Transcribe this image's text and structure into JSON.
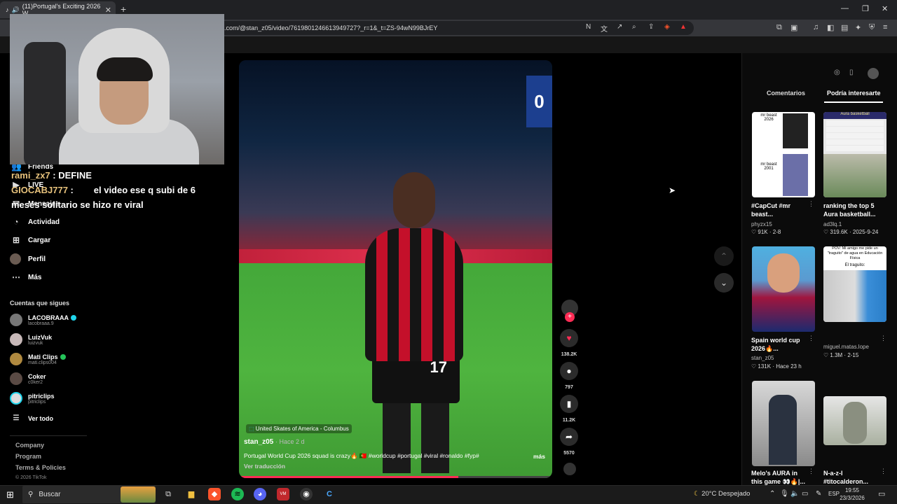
{
  "browser": {
    "tab_title": "(11)Portugal's Exciting 2026 W",
    "new_tab": "+",
    "url": ".com/@stan_z05/video/7619801246613949727?_r=1&_t=ZS-94wN99BJrEY"
  },
  "overlay_chat": {
    "line1_user": "rami_zx7",
    "line1_text": ": DEFINE",
    "line2_user": "GIOCABJ777",
    "line2_text": "el video ese q subi de 6",
    "line3_text": "meses solitario se hizo re viral"
  },
  "sidebar": {
    "partial_items": [
      "Friends",
      "LIVE",
      "Mensajes",
      "Actividad"
    ],
    "items": [
      {
        "label": "Cargar",
        "icon": "plus-square-icon"
      },
      {
        "label": "Perfil",
        "icon": "profile-icon"
      },
      {
        "label": "Más",
        "icon": "more-icon"
      }
    ],
    "following_title": "Cuentas que sigues",
    "accounts": [
      {
        "name": "LACOBRAAA",
        "handle": "lacobraaa.9",
        "badge": "verified"
      },
      {
        "name": "LuizVuk",
        "handle": "luizvuk",
        "badge": ""
      },
      {
        "name": "Mati Clips",
        "handle": "mati.clips004",
        "badge": "live"
      },
      {
        "name": "Coker",
        "handle": "c0ker2",
        "badge": ""
      },
      {
        "name": "pitriclips",
        "handle": "pitriclips",
        "badge": ""
      }
    ],
    "see_all": "Ver todo",
    "footer": [
      "Company",
      "Program",
      "Terms & Policies",
      "© 2026 TikTok"
    ]
  },
  "video": {
    "score_digit": "0",
    "jersey_number": "17",
    "location": "United Skates of America - Columbus",
    "author": "stan_z05",
    "time_ago": "· Hace 2 d",
    "caption": "Portugal World Cup 2026 squad is crazy🔥 🇵🇹 #worldcup #portugal #viral #ronaldo #fyp#",
    "more": "más",
    "translate": "Ver traducción",
    "progress": 0.7
  },
  "actions": {
    "likes": "138.2K",
    "comments": "797",
    "saves": "11.2K",
    "shares": "5570"
  },
  "right_panel": {
    "tab_comments": "Comentarios",
    "tab_recommended": "Podría interesarte",
    "cards": [
      {
        "thumb_text_a": "mr beast 2026",
        "thumb_text_b": "mr beast 2001",
        "title": "#CapCut #mr beast...",
        "user": "phyzx15",
        "likes": "91K",
        "date": "2-8"
      },
      {
        "thumb_text_a": "Aura basketball",
        "title": "ranking the top 5 Aura basketball...",
        "user": "ad3lq.1",
        "likes": "319.6K",
        "date": "2025-9-24"
      },
      {
        "title": "Spain world cup 2026🔥...",
        "user": "stan_z05",
        "likes": "131K",
        "date": "Hace 23 h"
      },
      {
        "thumb_text_a": "POV: Mi amigo me pide un \"traguito\" de agua en Educación Física",
        "thumb_text_b": "El traguito:",
        "title": "",
        "user": "miguel.matas.lope",
        "likes": "1.3M",
        "date": "2-15"
      },
      {
        "title": "Melo's AURA in this game 👀🔥|...",
        "user": "",
        "likes": "",
        "date": ""
      },
      {
        "title": "N-a-z-I #titocalderon...",
        "user": "",
        "likes": "",
        "date": ""
      }
    ]
  },
  "taskbar": {
    "search": "Buscar",
    "weather": "20°C  Despejado",
    "lang": "ESP",
    "time": "19:55",
    "date": "23/3/2026"
  }
}
